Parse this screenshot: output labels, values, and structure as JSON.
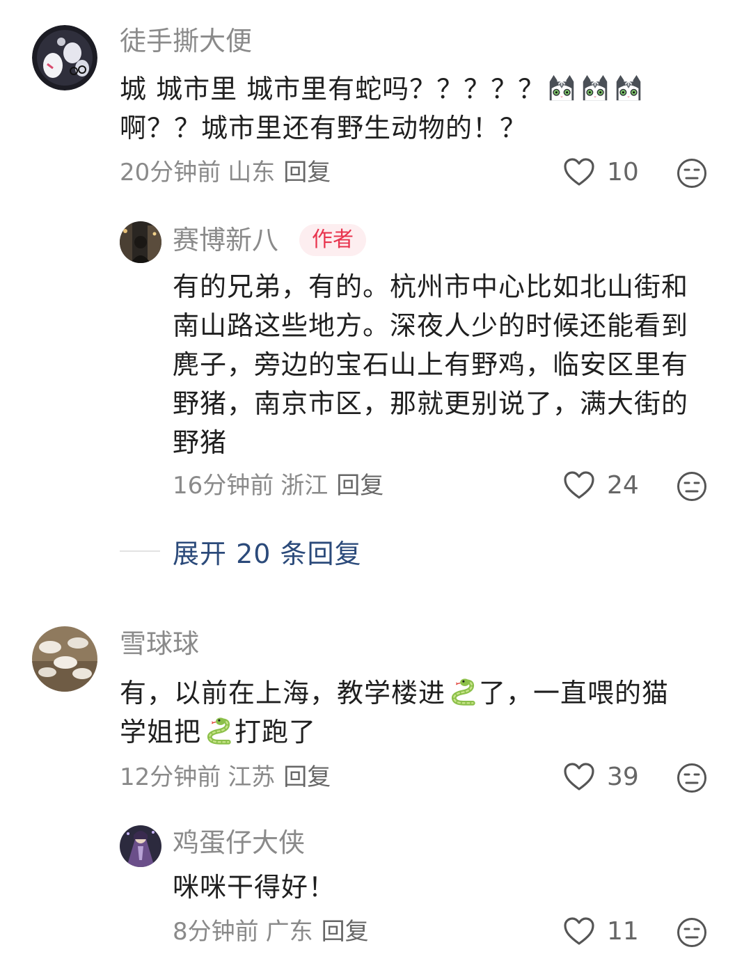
{
  "comments": [
    {
      "username": "徒手撕大便",
      "text_before": "城 城市里 城市里有蛇吗？？？？？",
      "emoji": [
        "cat-face-emoji",
        "cat-face-emoji",
        "cat-face-emoji"
      ],
      "text_after": "啊？？城市里还有野生动物的！？",
      "time": "20分钟前",
      "location": "山东",
      "reply_label": "回复",
      "likes": "10"
    },
    {
      "username": "赛博新八",
      "badge": "作者",
      "text": "有的兄弟，有的。杭州市中心比如北山街和南山路这些地方。深夜人少的时候还能看到麂子，旁边的宝石山上有野鸡，临安区里有野猪，南京市区，那就更别说了，满大街的野猪",
      "time": "16分钟前",
      "location": "浙江",
      "reply_label": "回复",
      "likes": "24"
    },
    {
      "username": "雪球球",
      "text_a": "有，以前在上海，教学楼进",
      "text_b": "了，一直喂的猫",
      "text_c": "学姐把",
      "text_d": "打跑了",
      "emoji": "snake-emoji",
      "time": "12分钟前",
      "location": "江苏",
      "reply_label": "回复",
      "likes": "39"
    },
    {
      "username": "鸡蛋仔大侠",
      "text": "咪咪干得好！",
      "time": "8分钟前",
      "location": "广东",
      "reply_label": "回复",
      "likes": "11"
    }
  ],
  "expand_replies": "展开 20 条回复",
  "icons": {
    "like": "heart-outline-icon",
    "dislike": "neutral-face-icon"
  },
  "colors": {
    "badge_text": "#e8344e",
    "badge_bg": "#fdeef0",
    "expand_text": "#2b4a7a",
    "meta_text": "#8a8a8a"
  }
}
